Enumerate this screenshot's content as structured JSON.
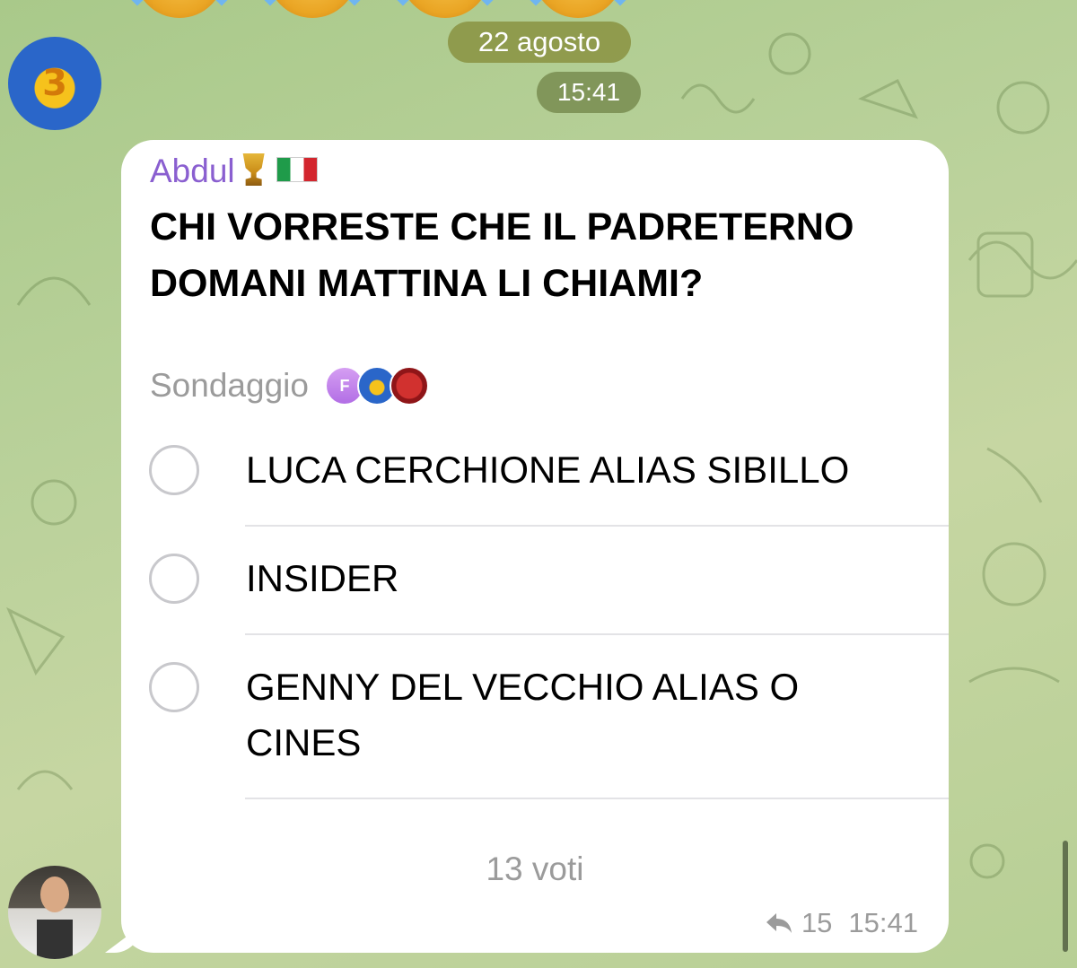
{
  "chat": {
    "date_label": "22 agosto",
    "time_label": "15:41",
    "top_emoji": "rolling-on-floor-laughing-emoji"
  },
  "message": {
    "sender": "Abdul",
    "sender_emoji": [
      "trophy",
      "italy-flag"
    ],
    "sender_color": "#8a5fd0",
    "question": "CHI VORRESTE CHE IL PADRETERNO DOMANI MATTINA LI CHIAMI?",
    "poll_type": "Sondaggio",
    "voter_avatars": [
      {
        "initial": "F",
        "color": "#c387ee"
      },
      {
        "initial": "",
        "color": "#2a66c9"
      },
      {
        "initial": "",
        "color": "#b72124"
      }
    ],
    "options": [
      {
        "label": "LUCA CERCHIONE ALIAS SIBILLO"
      },
      {
        "label": "INSIDER"
      },
      {
        "label": "GENNY DEL VECCHIO ALIAS O CINES"
      }
    ],
    "votes": "13 voti",
    "replies": "15",
    "time": "15:41"
  }
}
